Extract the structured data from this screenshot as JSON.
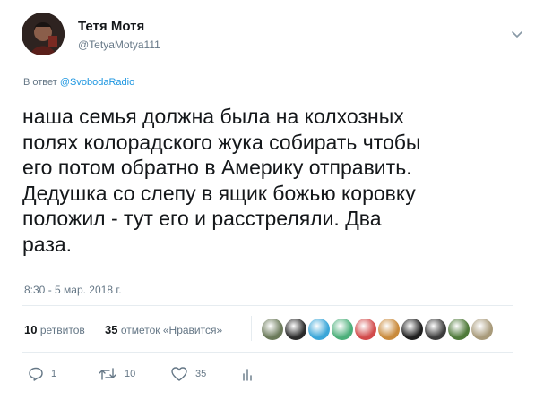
{
  "user": {
    "display_name": "Тетя Мотя",
    "handle": "@TetyaMotya111"
  },
  "reply": {
    "prefix": "В ответ",
    "mention": "@SvobodaRadio"
  },
  "tweet": {
    "text": "наша семья должна была на колхозных\nполях колорадского жука собирать чтобы\nего потом обратно в Америку отправить.\nДедушка со слепу в ящик божью коровку\nположил - тут его и расстреляли. Два\nраза.",
    "timestamp": "8:30 - 5 мар. 2018 г."
  },
  "stats": {
    "retweets_count": "10",
    "retweets_label": "ретвитов",
    "likes_count": "35",
    "likes_label": "отметок «Нравится»"
  },
  "likers": [
    {
      "icon": "liker-avatar-1",
      "color": "#6b7a5a"
    },
    {
      "icon": "liker-avatar-2",
      "color": "#2b2b2b"
    },
    {
      "icon": "liker-avatar-3",
      "color": "#3aa6d8"
    },
    {
      "icon": "liker-avatar-4",
      "color": "#4caf7a"
    },
    {
      "icon": "liker-avatar-5",
      "color": "#d24b4b"
    },
    {
      "icon": "liker-avatar-6",
      "color": "#c98a3b"
    },
    {
      "icon": "liker-avatar-7",
      "color": "#1f1f1f"
    },
    {
      "icon": "liker-avatar-8",
      "color": "#3c3c3c"
    },
    {
      "icon": "liker-avatar-9",
      "color": "#4f7a3a"
    },
    {
      "icon": "liker-avatar-10",
      "color": "#a89a7a"
    }
  ],
  "actions": {
    "reply_count": "1",
    "retweet_count": "10",
    "like_count": "35",
    "reply_icon": "reply-icon",
    "retweet_icon": "retweet-icon",
    "like_icon": "heart-icon",
    "analytics_icon": "analytics-icon"
  },
  "colors": {
    "text": "#14171a",
    "secondary": "#657786",
    "link": "#1b95e0",
    "divider": "#e6ecf0"
  }
}
